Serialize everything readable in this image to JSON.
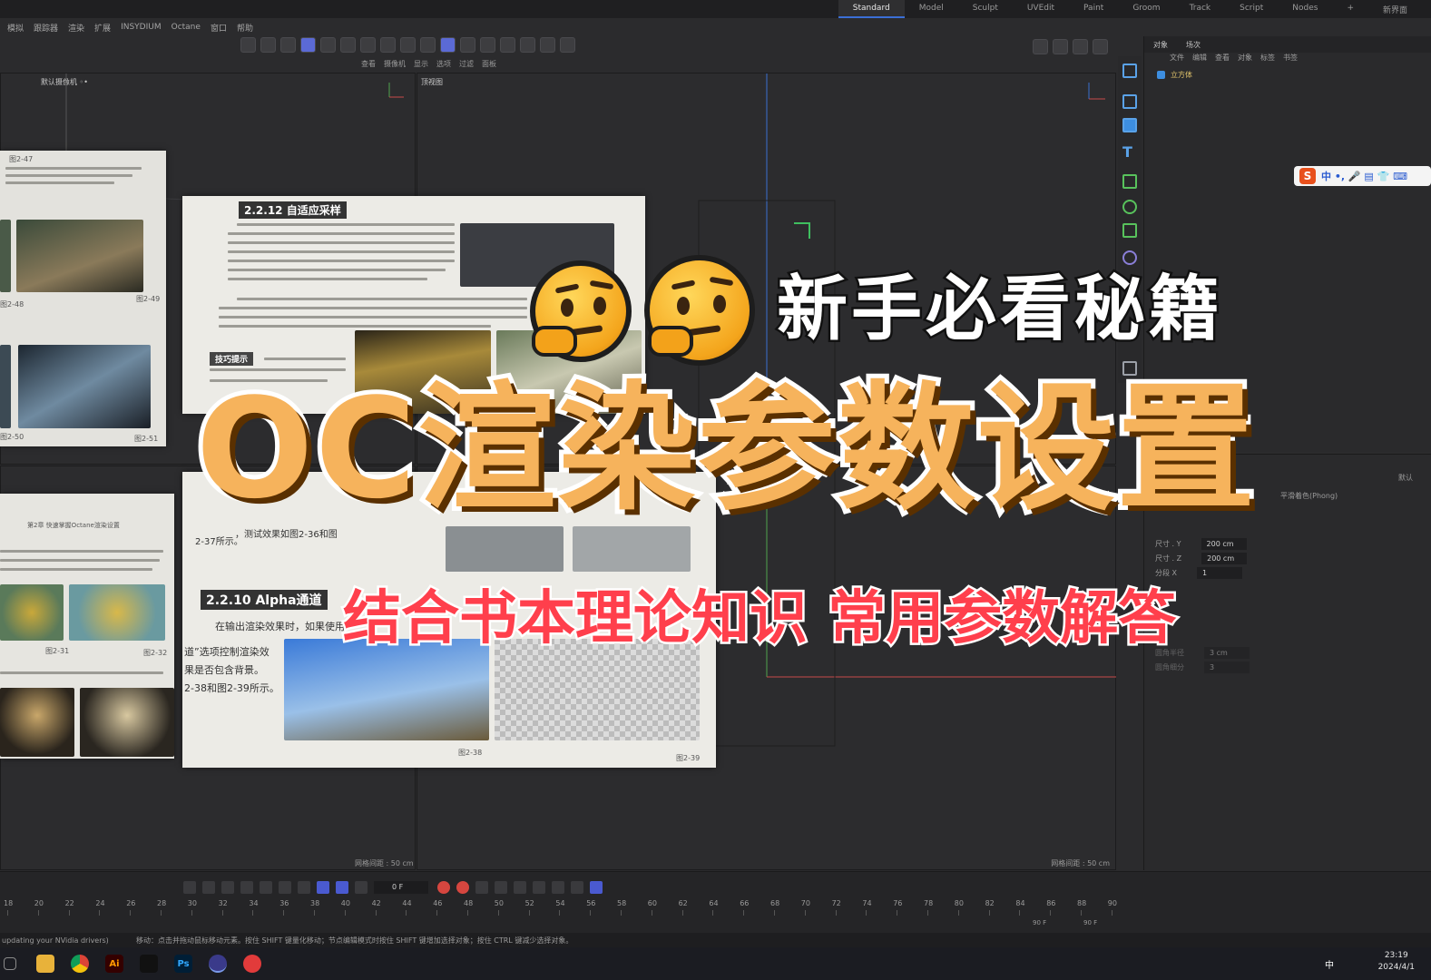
{
  "layouts": [
    "Standard",
    "Model",
    "Sculpt",
    "UVEdit",
    "Paint",
    "Groom",
    "Track",
    "Script",
    "Nodes"
  ],
  "layout_plus": "+",
  "layout_new": "新界面",
  "menu": [
    "模拟",
    "跟踪器",
    "渲染",
    "扩展",
    "INSYDIUM",
    "Octane",
    "窗口",
    "帮助"
  ],
  "viewport_submenu": [
    "查看",
    "摄像机",
    "显示",
    "选项",
    "过滤",
    "面板"
  ],
  "viewports": {
    "top_left_label": "默认摄像机 ◦•",
    "top_right_label": "顶视图",
    "grid_spacing_left": "网格间距 : 50 cm",
    "grid_spacing_right": "网格间距 : 50 cm"
  },
  "object_manager": {
    "tabs": [
      "对象",
      "场次"
    ],
    "menu": [
      "文件",
      "编辑",
      "查看",
      "对象",
      "标签",
      "书签"
    ],
    "object_name": "立方体"
  },
  "attribute_manager": {
    "mode": "默认",
    "shader": "平滑着色(Phong)",
    "rows": [
      {
        "label": "尺寸 . Y",
        "value": "200 cm"
      },
      {
        "label": "尺寸 . Z",
        "value": "200 cm"
      },
      {
        "label": "分段 X",
        "value": "1"
      }
    ],
    "fillet_label": "圆角半径",
    "fillet_value": "3 cm",
    "fillet_seg_label": "圆角细分",
    "fillet_seg_value": "3"
  },
  "ime": {
    "logo": "S",
    "text": "中 •, 🎤 ▤ 👕 ⌨"
  },
  "timeline": {
    "current_frame": "0 F",
    "ticks": [
      "18",
      "20",
      "22",
      "24",
      "26",
      "28",
      "30",
      "32",
      "34",
      "36",
      "38",
      "40",
      "42",
      "44",
      "46",
      "48",
      "50",
      "52",
      "54",
      "56",
      "58",
      "60",
      "62",
      "64",
      "66",
      "68",
      "70",
      "72",
      "74",
      "76",
      "78",
      "80",
      "82",
      "84",
      "86",
      "88",
      "90"
    ],
    "end_a": "90 F",
    "end_b": "90 F"
  },
  "status": {
    "left": "updating your NVidia drivers)",
    "main": "移动：点击并拖动鼠标移动元素。按住 SHIFT 键量化移动；节点编辑模式时按住 SHIFT 键增加选择对象；按住 CTRL 键减少选择对象。"
  },
  "taskbar": {
    "time": "23:19",
    "date": "2024/4/1",
    "ai": "Ai",
    "ps": "Ps",
    "lang": "中"
  },
  "book": {
    "heading_adaptive": "2.2.12  自适应采样",
    "heading_alpha": "2.2.10  Alpha通道",
    "tip_label": "技巧提示",
    "chapter_header": "第2章  快速掌握Octane渲染设置",
    "figures": [
      "图2-47",
      "图2-48",
      "图2-49",
      "图2-50",
      "图2-51",
      "图2-38",
      "图2-39",
      "图2-31",
      "图2-32"
    ],
    "alpha_text": [
      "在输出渲染效果时，如果使用",
      "道”选项控制渲染效",
      "果是否包含背景。",
      "2-38和图2-39所示。"
    ],
    "side_text": "，测试效果如图2-36和图",
    "side_text2": "2-37所示。"
  },
  "overlay": {
    "title_top": "新手必看秘籍",
    "title_main": "OC渲染参数设置",
    "title_sub": "结合书本理论知识 常用参数解答"
  },
  "colors": {
    "accent": "#3b6fd6",
    "title_orange": "#f6b35c",
    "subtitle_red": "#ff3f4c",
    "object_yellow": "#e2c46b"
  }
}
